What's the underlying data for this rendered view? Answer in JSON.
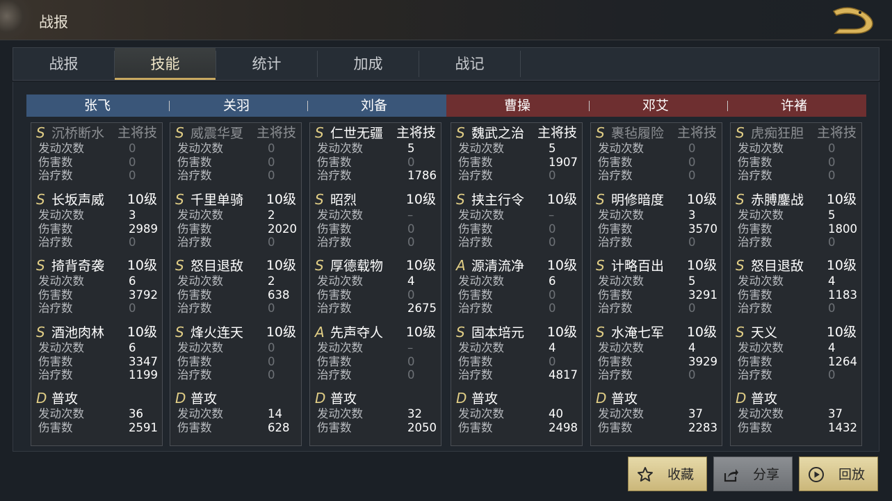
{
  "header": {
    "title": "战报"
  },
  "tabs": [
    {
      "label": "战报",
      "active": false
    },
    {
      "label": "技能",
      "active": true
    },
    {
      "label": "统计",
      "active": false
    },
    {
      "label": "加成",
      "active": false
    },
    {
      "label": "战记",
      "active": false
    }
  ],
  "stat_labels": {
    "activations": "发动次数",
    "damage": "伤害数",
    "healing": "治疗数"
  },
  "teams": {
    "left_color": "#3a5679",
    "right_color": "#6e2f30"
  },
  "generals": [
    {
      "name": "张飞",
      "team": "left",
      "skills": [
        {
          "grade": "S",
          "name": "沉桥断水",
          "level": "主将技",
          "dim": true,
          "activations": "0",
          "damage": "0",
          "healing": "0"
        },
        {
          "grade": "S",
          "name": "长坂声威",
          "level": "10级",
          "dim": false,
          "activations": "3",
          "damage": "2989",
          "healing": "0"
        },
        {
          "grade": "S",
          "name": "掎背奇袭",
          "level": "10级",
          "dim": false,
          "activations": "6",
          "damage": "3792",
          "healing": "0"
        },
        {
          "grade": "S",
          "name": "酒池肉林",
          "level": "10级",
          "dim": false,
          "activations": "6",
          "damage": "3347",
          "healing": "1199"
        }
      ],
      "attack": {
        "grade": "D",
        "name": "普攻",
        "activations": "36",
        "damage": "2591"
      }
    },
    {
      "name": "关羽",
      "team": "left",
      "skills": [
        {
          "grade": "S",
          "name": "威震华夏",
          "level": "主将技",
          "dim": true,
          "activations": "0",
          "damage": "0",
          "healing": "0"
        },
        {
          "grade": "S",
          "name": "千里单骑",
          "level": "10级",
          "dim": false,
          "activations": "2",
          "damage": "2020",
          "healing": "0"
        },
        {
          "grade": "S",
          "name": "怒目退敌",
          "level": "10级",
          "dim": false,
          "activations": "2",
          "damage": "638",
          "healing": "0"
        },
        {
          "grade": "S",
          "name": "烽火连天",
          "level": "10级",
          "dim": false,
          "activations": "0",
          "damage": "0",
          "healing": "0"
        }
      ],
      "attack": {
        "grade": "D",
        "name": "普攻",
        "activations": "14",
        "damage": "628"
      }
    },
    {
      "name": "刘备",
      "team": "left",
      "skills": [
        {
          "grade": "S",
          "name": "仁世无疆",
          "level": "主将技",
          "dim": false,
          "activations": "5",
          "damage": "0",
          "healing": "1786"
        },
        {
          "grade": "S",
          "name": "昭烈",
          "level": "10级",
          "dim": false,
          "activations": "–",
          "damage": "0",
          "healing": "0"
        },
        {
          "grade": "S",
          "name": "厚德载物",
          "level": "10级",
          "dim": false,
          "activations": "4",
          "damage": "0",
          "healing": "2675"
        },
        {
          "grade": "A",
          "name": "先声夺人",
          "level": "10级",
          "dim": false,
          "activations": "–",
          "damage": "0",
          "healing": "0"
        }
      ],
      "attack": {
        "grade": "D",
        "name": "普攻",
        "activations": "32",
        "damage": "2050"
      }
    },
    {
      "name": "曹操",
      "team": "right",
      "skills": [
        {
          "grade": "S",
          "name": "魏武之治",
          "level": "主将技",
          "dim": false,
          "activations": "5",
          "damage": "1907",
          "healing": "0"
        },
        {
          "grade": "S",
          "name": "挟主行令",
          "level": "10级",
          "dim": false,
          "activations": "–",
          "damage": "0",
          "healing": "0"
        },
        {
          "grade": "A",
          "name": "源清流净",
          "level": "10级",
          "dim": false,
          "activations": "6",
          "damage": "0",
          "healing": "0"
        },
        {
          "grade": "S",
          "name": "固本培元",
          "level": "10级",
          "dim": false,
          "activations": "4",
          "damage": "0",
          "healing": "4817"
        }
      ],
      "attack": {
        "grade": "D",
        "name": "普攻",
        "activations": "40",
        "damage": "2498"
      }
    },
    {
      "name": "邓艾",
      "team": "right",
      "skills": [
        {
          "grade": "S",
          "name": "裹毡履险",
          "level": "主将技",
          "dim": true,
          "activations": "0",
          "damage": "0",
          "healing": "0"
        },
        {
          "grade": "S",
          "name": "明修暗度",
          "level": "10级",
          "dim": false,
          "activations": "3",
          "damage": "3570",
          "healing": "0"
        },
        {
          "grade": "S",
          "name": "计略百出",
          "level": "10级",
          "dim": false,
          "activations": "5",
          "damage": "3291",
          "healing": "0"
        },
        {
          "grade": "S",
          "name": "水淹七军",
          "level": "10级",
          "dim": false,
          "activations": "4",
          "damage": "3929",
          "healing": "0"
        }
      ],
      "attack": {
        "grade": "D",
        "name": "普攻",
        "activations": "37",
        "damage": "2283"
      }
    },
    {
      "name": "许褚",
      "team": "right",
      "skills": [
        {
          "grade": "S",
          "name": "虎痴狂胆",
          "level": "主将技",
          "dim": true,
          "activations": "0",
          "damage": "0",
          "healing": "0"
        },
        {
          "grade": "S",
          "name": "赤膊鏖战",
          "level": "10级",
          "dim": false,
          "activations": "5",
          "damage": "1800",
          "healing": "0"
        },
        {
          "grade": "S",
          "name": "怒目退敌",
          "level": "10级",
          "dim": false,
          "activations": "4",
          "damage": "1183",
          "healing": "0"
        },
        {
          "grade": "S",
          "name": "天义",
          "level": "10级",
          "dim": false,
          "activations": "4",
          "damage": "1264",
          "healing": "0"
        }
      ],
      "attack": {
        "grade": "D",
        "name": "普攻",
        "activations": "37",
        "damage": "1432"
      }
    }
  ],
  "buttons": {
    "favorite": {
      "label": "收藏",
      "icon": "star-icon"
    },
    "share": {
      "label": "分享",
      "icon": "share-icon"
    },
    "replay": {
      "label": "回放",
      "icon": "play-icon"
    }
  },
  "icons": {
    "back": "dragon-back-icon"
  }
}
